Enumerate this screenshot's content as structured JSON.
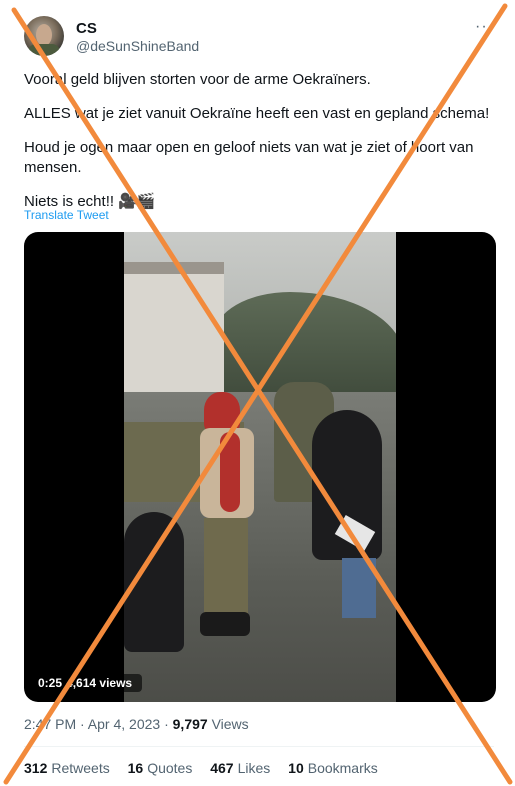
{
  "user": {
    "display_name": "CS",
    "handle": "@deSunShineBand",
    "more_label": "···"
  },
  "tweet": {
    "paragraphs": [
      "Vooral geld blijven storten voor de arme Oekraïners.",
      "ALLES wat je ziet vanuit Oekraïne heeft een vast en gepland schema!",
      "Houd je ogen maar open en geloof niets van wat je ziet of hoort van mensen.",
      "Niets is echt!! 🎥🎬"
    ],
    "translate_label": "Translate Tweet"
  },
  "video": {
    "elapsed": "0:25",
    "views": "4,614 views"
  },
  "meta": {
    "time": "2:47 PM · Apr 4, 2023 · ",
    "views_count": "9,797",
    "views_label": " Views"
  },
  "stats": [
    {
      "count": "312",
      "label": "Retweets"
    },
    {
      "count": "16",
      "label": "Quotes"
    },
    {
      "count": "467",
      "label": "Likes"
    },
    {
      "count": "10",
      "label": "Bookmarks"
    }
  ],
  "colors": {
    "link": "#1d9bf0",
    "muted": "#536471",
    "cross": "#f28a3c"
  }
}
